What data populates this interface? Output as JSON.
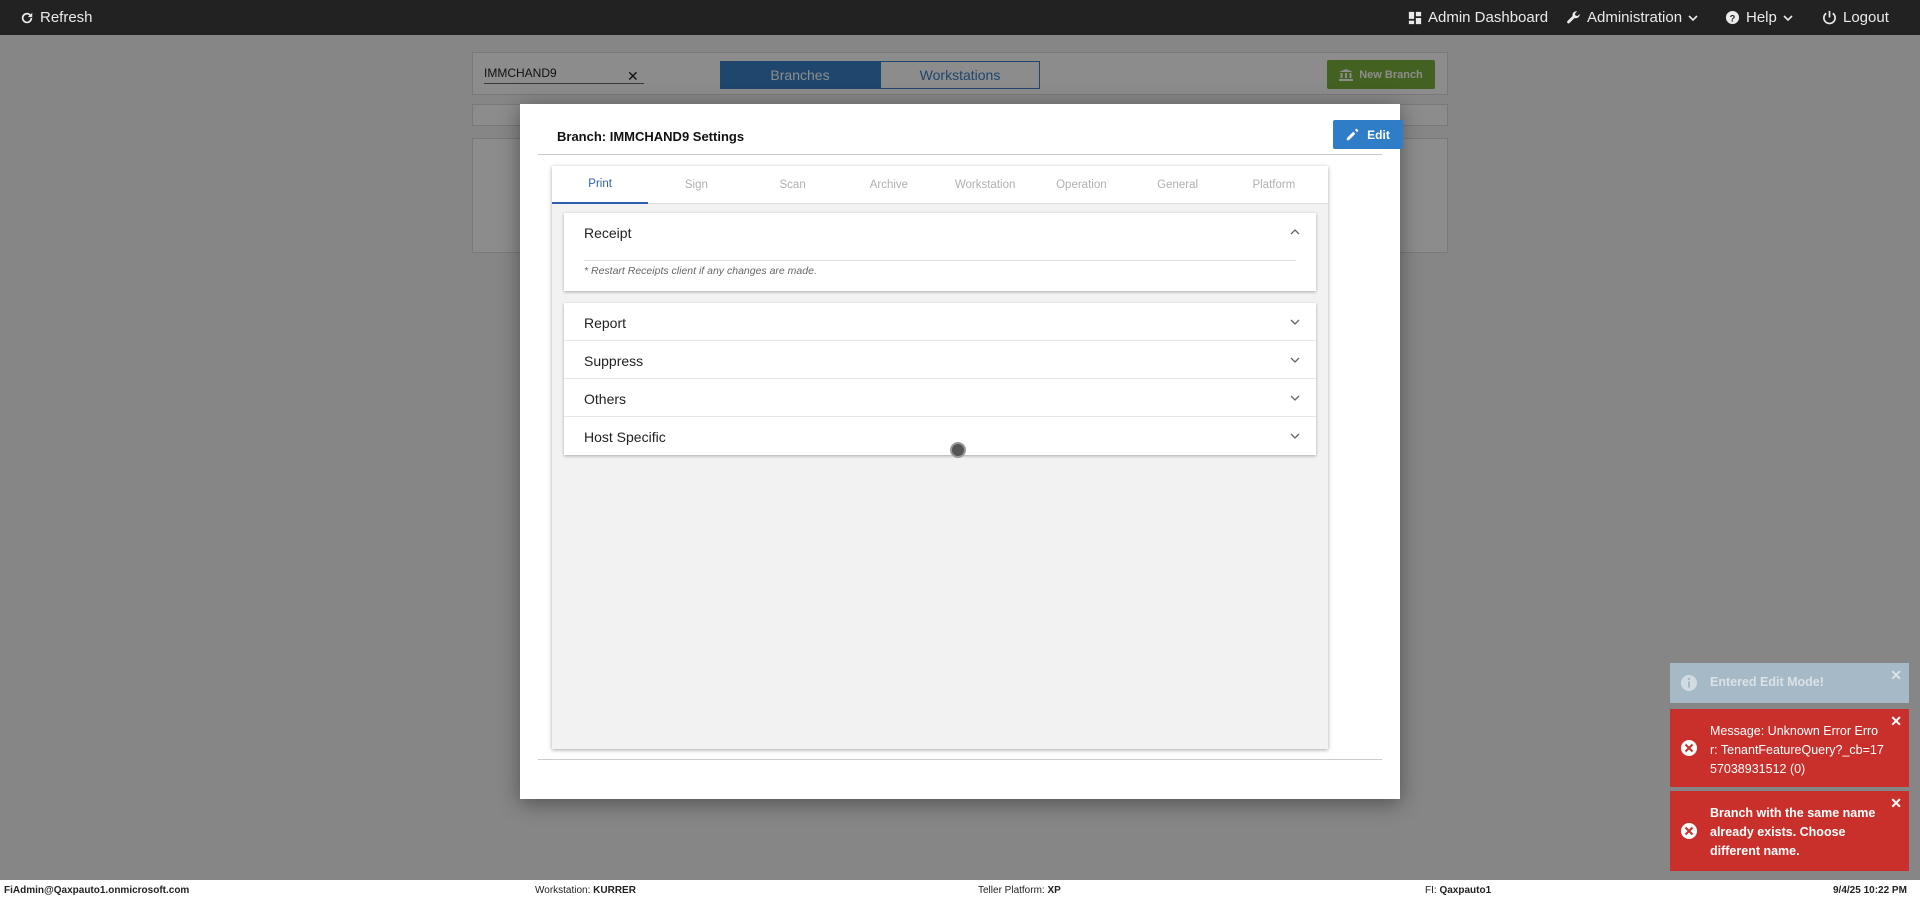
{
  "topbar": {
    "refresh_label": "Refresh",
    "admin_dashboard_label": "Admin Dashboard",
    "administration_label": "Administration",
    "help_label": "Help",
    "logout_label": "Logout"
  },
  "background": {
    "search_value": "IMMCHAND9",
    "segments": [
      "Branches",
      "Workstations"
    ],
    "new_branch_label": "New Branch"
  },
  "modal": {
    "title": "Branch: IMMCHAND9 Settings",
    "edit_label": "Edit",
    "tabs": [
      "Print",
      "Sign",
      "Scan",
      "Archive",
      "Workstation",
      "Operation",
      "General",
      "Platform"
    ],
    "active_tab": "Print",
    "receipt": {
      "label": "Receipt",
      "note": "* Restart Receipts client if any changes are made."
    },
    "sections": [
      "Report",
      "Suppress",
      "Others",
      "Host Specific"
    ]
  },
  "toasts": {
    "info": "Entered Edit Mode!",
    "error1": "Message: Unknown Error Error: TenantFeatureQuery?_cb=1757038931512 (0)",
    "error2": "Branch with the same name already exists. Choose different name."
  },
  "statusbar": {
    "user": "FiAdmin@Qaxpauto1.onmicrosoft.com",
    "workstation_label": "Workstation:",
    "workstation_value": "KURRER",
    "platform_label": "Teller Platform:",
    "platform_value": "XP",
    "fi_label": "FI:",
    "fi_value": "Qaxpauto1",
    "datetime": "9/4/25 10:22 PM"
  },
  "colors": {
    "accent_blue": "#2f7cc7",
    "new_branch_green": "#7ab13b",
    "error_red": "#c9302c"
  }
}
